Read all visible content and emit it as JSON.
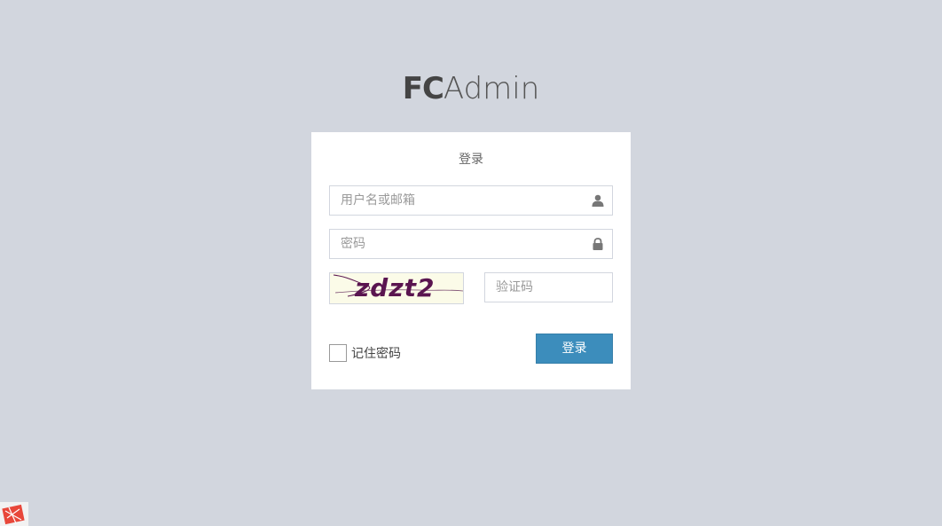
{
  "logo": {
    "bold": "FC",
    "light": "Admin"
  },
  "login_box": {
    "message": "登录",
    "username": {
      "placeholder": "用户名或邮箱",
      "value": "",
      "icon": "user-icon"
    },
    "password": {
      "placeholder": "密码",
      "value": "",
      "icon": "lock-icon"
    },
    "captcha": {
      "image_text": "zdzt2",
      "placeholder": "验证码",
      "value": ""
    },
    "remember": {
      "label": "记住密码",
      "checked": false
    },
    "submit_label": "登录"
  },
  "colors": {
    "background": "#d2d6de",
    "primary": "#3c8dbc",
    "captcha_text": "#5a1550"
  },
  "corner_badge": {
    "icon": "app-logo-icon"
  }
}
